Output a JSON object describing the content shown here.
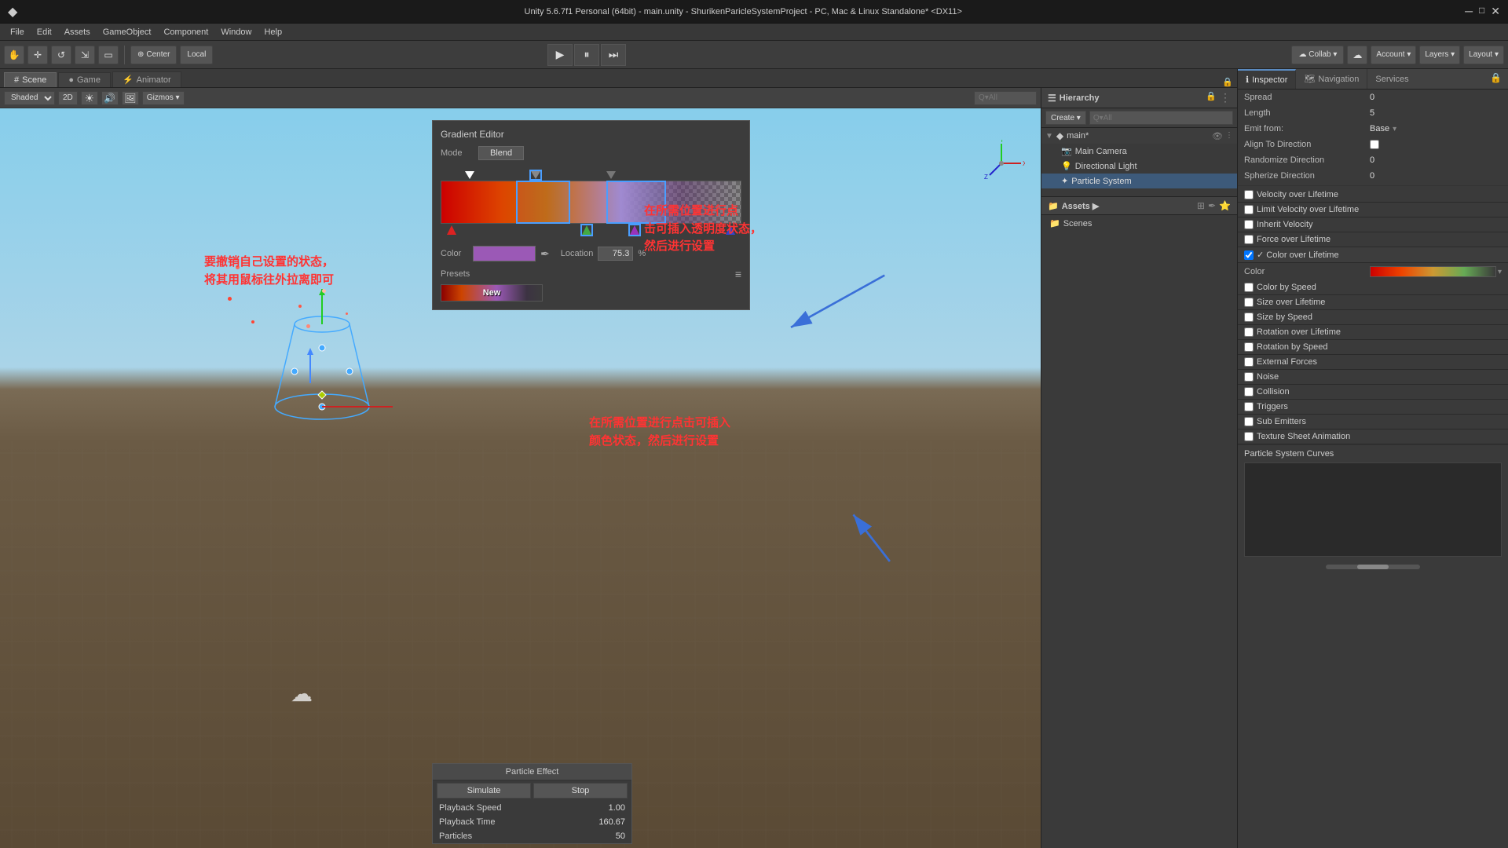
{
  "titlebar": {
    "title": "Unity 5.6.7f1 Personal (64bit) - main.unity - ShurikenParicleSystemProject - PC, Mac & Linux Standalone* <DX11>",
    "logo": "◆"
  },
  "menu": {
    "items": [
      "File",
      "Edit",
      "Assets",
      "GameObject",
      "Component",
      "Window",
      "Help"
    ]
  },
  "toolbar": {
    "hand_tool": "✋",
    "move_tool": "✛",
    "rotate_tool": "↺",
    "scale_tool": "⇔",
    "rect_tool": "▭",
    "pivot_center": "Center",
    "pivot_local": "Local",
    "play": "▶",
    "pause": "⏸",
    "step": "⏭",
    "collab": "Collab ▾",
    "cloud_icon": "☁",
    "account": "Account ▾",
    "layers": "Layers ▾",
    "layout": "Layout ▾"
  },
  "scene_tabs": {
    "tabs": [
      {
        "label": "# Scene",
        "active": true
      },
      {
        "label": "● Game",
        "active": false
      },
      {
        "label": "⚡ Animator",
        "active": false
      }
    ],
    "shading_mode": "Shaded",
    "is_2d": "2D",
    "gizmos": "Gizmos ▾",
    "search_placeholder": "Q▾All"
  },
  "hierarchy": {
    "title": "Hierarchy",
    "create_btn": "Create ▾",
    "search_placeholder": "Q▾All",
    "scene_name": "main*",
    "items": [
      {
        "label": "Main Camera",
        "indent": 1,
        "icon": "📷"
      },
      {
        "label": "Directional Light",
        "indent": 1,
        "icon": "💡"
      },
      {
        "label": "Particle System",
        "indent": 1,
        "icon": "✦",
        "selected": true
      }
    ]
  },
  "inspector": {
    "title": "Inspector",
    "nav_tab": "Navigation",
    "services_tab": "Services",
    "rows": [
      {
        "label": "Spread",
        "value": "0"
      },
      {
        "label": "Length",
        "value": "5"
      },
      {
        "label": "Emit from:",
        "value": "Base"
      },
      {
        "label": "Align To Direction",
        "checkbox": true,
        "checked": false
      },
      {
        "label": "Randomize Direction",
        "value": "0"
      },
      {
        "label": "Spherize Direction",
        "value": "0"
      }
    ],
    "sections": [
      {
        "label": "Velocity over Lifetime",
        "enabled": false
      },
      {
        "label": "Limit Velocity over Lifetime",
        "enabled": false
      },
      {
        "label": "Inherit Velocity",
        "enabled": false
      },
      {
        "label": "Force over Lifetime",
        "enabled": false
      },
      {
        "label": "Color over Lifetime",
        "enabled": true
      }
    ],
    "color_label": "Color",
    "more_sections": [
      {
        "label": "Color by Speed",
        "enabled": false
      },
      {
        "label": "Size over Lifetime",
        "enabled": false
      },
      {
        "label": "Size by Speed",
        "enabled": false
      },
      {
        "label": "Rotation over Lifetime",
        "enabled": false
      },
      {
        "label": "Rotation by Speed",
        "enabled": false
      },
      {
        "label": "External Forces",
        "enabled": false
      },
      {
        "label": "Noise",
        "enabled": false
      },
      {
        "label": "Collision",
        "enabled": false
      },
      {
        "label": "Triggers",
        "enabled": false
      },
      {
        "label": "Sub Emitters",
        "enabled": false
      },
      {
        "label": "Texture Sheet Animation",
        "enabled": false
      }
    ]
  },
  "gradient_editor": {
    "title": "Gradient Editor",
    "mode_label": "Mode",
    "mode_value": "Blend",
    "color_label": "Color",
    "color_hex": "#9b59b6",
    "location_label": "Location",
    "location_value": "75.3",
    "percent_symbol": "%",
    "presets_label": "Presets",
    "presets_menu": "≡",
    "new_label": "New"
  },
  "particle_effect": {
    "title": "Particle Effect",
    "simulate_btn": "Simulate",
    "stop_btn": "Stop",
    "playback_speed_label": "Playback Speed",
    "playback_speed_value": "1.00",
    "playback_time_label": "Playback Time",
    "playback_time_value": "160.67",
    "particles_label": "Particles",
    "particles_value": "50"
  },
  "assets": {
    "title": "Assets ▶",
    "folders": [
      {
        "label": "Scenes"
      }
    ]
  },
  "annotations": {
    "text1": "要撤销自己设置的状态，\n将其用鼠标往外拉离即可",
    "text2": "在所需位置进行点\n击可插入透明度状态，\n然后进行设置",
    "text3": "在所需位置进行点击可插入\n颜色状态，然后进行设置"
  },
  "curves_section": {
    "title": "Particle System Curves"
  }
}
